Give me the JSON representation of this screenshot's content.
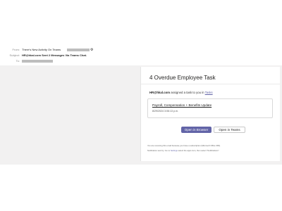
{
  "header": {
    "from_label": "From:",
    "from_value": "There's New Activity On Teams",
    "subject_label": "Subject:",
    "subject_value": "HR@hkal.com Sent 2 Messages Via Teams Chat.",
    "to_label": "To:"
  },
  "card": {
    "title": "4 Overdue Employee Task",
    "assigned_sender": "HR@hkal.com",
    "assigned_text": "assigned a task to you in",
    "assigned_link": "Tasks",
    "task_title": "Payroll, Compensation + Benefits Update",
    "task_date": "8/29/2024 3:06:13 p.m.",
    "primary_button": "Open in Browser",
    "secondary_button": "Open in Teams",
    "footer_line1": "You are receiving this email because you have a subscription (Microsoft Office 365).",
    "footer_line2_pre": "Notification sent by: Go to",
    "footer_line2_link": "Settings",
    "footer_line2_post": "select the apps icon, then select \"Notifications\"."
  },
  "colors": {
    "accent": "#6264a7",
    "page_background": "#f2f1f1",
    "redaction": "#bdbdbd"
  },
  "icons": {
    "settings": "gear-icon"
  }
}
